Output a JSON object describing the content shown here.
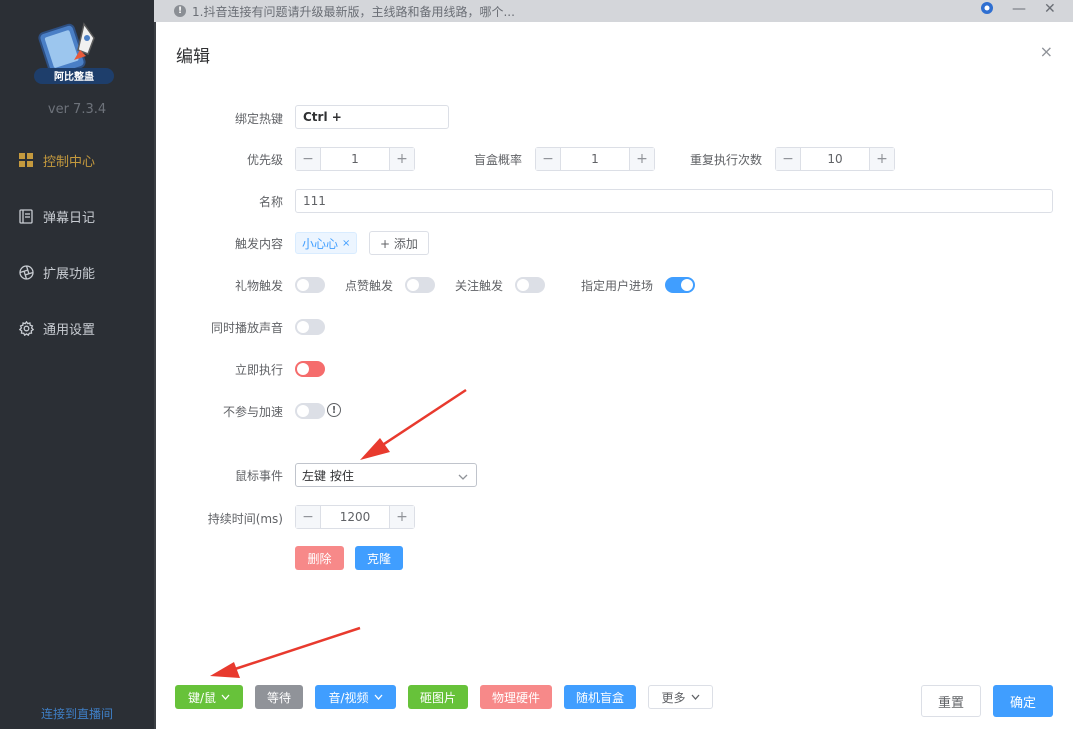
{
  "app": {
    "logo_text": "阿比整蛊",
    "version": "ver 7.3.4",
    "footer_link": "连接到直播间"
  },
  "sidebar": {
    "items": [
      {
        "label": "控制中心",
        "icon": "grid-icon",
        "active": true
      },
      {
        "label": "弹幕日记",
        "icon": "notebook-icon",
        "active": false
      },
      {
        "label": "扩展功能",
        "icon": "aperture-icon",
        "active": false
      },
      {
        "label": "通用设置",
        "icon": "gear-icon",
        "active": false
      }
    ]
  },
  "topbar": {
    "notice": "1.抖音连接有问题请升级最新版，主线路和备用线路，哪个..."
  },
  "dialog": {
    "title": "编辑",
    "close": "×",
    "hotkey": {
      "label": "绑定热键",
      "value": "Ctrl +"
    },
    "priority": {
      "label": "优先级",
      "value": "1"
    },
    "blindbox_prob": {
      "label": "盲盒概率",
      "value": "1"
    },
    "repeat_count": {
      "label": "重复执行次数",
      "value": "10"
    },
    "name": {
      "label": "名称",
      "value": "111"
    },
    "trigger": {
      "label": "触发内容",
      "tag": "小心心",
      "tag_close": "×",
      "add_label": "+ 添加"
    },
    "switches": {
      "gift": {
        "label": "礼物触发",
        "on": false
      },
      "like": {
        "label": "点赞触发",
        "on": false
      },
      "follow": {
        "label": "关注触发",
        "on": false
      },
      "user_enter": {
        "label": "指定用户进场",
        "on": true
      },
      "play_sound": {
        "label": "同时播放声音",
        "on": false
      },
      "execute_now": {
        "label": "立即执行",
        "on": false
      },
      "no_accel": {
        "label": "不参与加速",
        "on": false
      }
    },
    "mouse_event": {
      "label": "鼠标事件",
      "value": "左键 按住"
    },
    "duration": {
      "label": "持续时间(ms)",
      "value": "1200"
    },
    "delete_label": "删除",
    "clone_label": "克隆",
    "footer": {
      "keymouse": "键/鼠",
      "wait": "等待",
      "av": "音/视频",
      "image": "砸图片",
      "hardware": "物理硬件",
      "random_box": "随机盲盒",
      "more": "更多",
      "reset": "重置",
      "confirm": "确定"
    }
  },
  "colors": {
    "primary": "#409eff",
    "success": "#67c23a",
    "danger": "#f56c6c",
    "sidebar_bg": "#2b2f35",
    "active_nav": "#c59a3e",
    "annotation_arrow": "#e83a2e"
  }
}
